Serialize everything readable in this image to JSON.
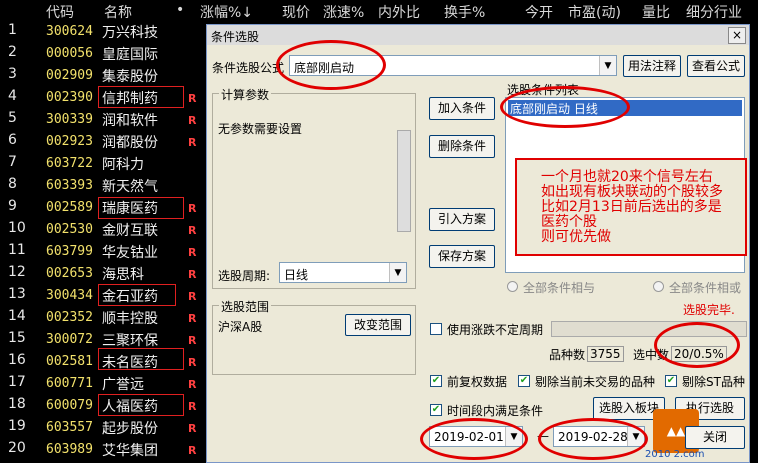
{
  "header": {
    "cols": [
      "代码",
      "名称",
      "•",
      "涨幅%↓",
      "现价",
      "涨速%",
      "内外比",
      "换手%",
      "今开",
      "市盈(动)",
      "量比",
      "细分行业"
    ]
  },
  "stocks": [
    {
      "num": "1",
      "code": "300624",
      "name": "万兴科技",
      "flag": ""
    },
    {
      "num": "2",
      "code": "000056",
      "name": "皇庭国际",
      "flag": ""
    },
    {
      "num": "3",
      "code": "002909",
      "name": "集泰股份",
      "flag": ""
    },
    {
      "num": "4",
      "code": "002390",
      "name": "信邦制药",
      "flag": "R"
    },
    {
      "num": "5",
      "code": "300339",
      "name": "润和软件",
      "flag": "R"
    },
    {
      "num": "6",
      "code": "002923",
      "name": "润都股份",
      "flag": "R"
    },
    {
      "num": "7",
      "code": "603722",
      "name": "阿科力",
      "flag": ""
    },
    {
      "num": "8",
      "code": "603393",
      "name": "新天然气",
      "flag": ""
    },
    {
      "num": "9",
      "code": "002589",
      "name": "瑞康医药",
      "flag": "R"
    },
    {
      "num": "10",
      "code": "002530",
      "name": "金财互联",
      "flag": "R"
    },
    {
      "num": "11",
      "code": "603799",
      "name": "华友钴业",
      "flag": "R"
    },
    {
      "num": "12",
      "code": "002653",
      "name": "海思科",
      "flag": "R"
    },
    {
      "num": "13",
      "code": "300434",
      "name": "金石亚药",
      "flag": "R"
    },
    {
      "num": "14",
      "code": "002352",
      "name": "顺丰控股",
      "flag": "R"
    },
    {
      "num": "15",
      "code": "300072",
      "name": "三聚环保",
      "flag": "R"
    },
    {
      "num": "16",
      "code": "002581",
      "name": "未名医药",
      "flag": "R"
    },
    {
      "num": "17",
      "code": "600771",
      "name": "广誉远",
      "flag": "R"
    },
    {
      "num": "18",
      "code": "600079",
      "name": "人福医药",
      "flag": "R"
    },
    {
      "num": "19",
      "code": "603557",
      "name": "起步股份",
      "flag": "R"
    },
    {
      "num": "20",
      "code": "603989",
      "name": "艾华集团",
      "flag": "R"
    }
  ],
  "dialog": {
    "title": "条件选股",
    "close": "×",
    "formula_label": "条件选股公式",
    "formula_value": "底部刚启动",
    "usage_btn": "用法注释",
    "view_btn": "查看公式",
    "params_group": "计算参数",
    "params_text": "无参数需要设置",
    "period_label": "选股周期:",
    "period_value": "日线",
    "add_btn": "加入条件",
    "delete_btn": "删除条件",
    "import_btn": "引入方案",
    "save_btn": "保存方案",
    "cond_list_label": "选股条件列表",
    "cond_item": "底部刚启动   日线",
    "radio_and": "全部条件相与",
    "radio_or": "全部条件相或",
    "done_text": "选股完毕.",
    "scope_group": "选股范围",
    "scope_value": "沪深A股",
    "change_scope_btn": "改变范围",
    "use_limit_label": "使用涨跌不定周期",
    "count_label": "品种数",
    "count_value": "3755",
    "selected_label": "选中数",
    "selected_value": "20/0.5%",
    "opt_adjusted": "前复权数据",
    "opt_exclude_untraded": "剔除当前未交易的品种",
    "opt_exclude_st": "剔除ST品种",
    "opt_time_range": "时间段内满足条件",
    "select_to_board_btn": "选股入板块",
    "execute_btn": "执行选股",
    "date_from": "2019-02-01",
    "date_to": "2019-02-28",
    "close_btn": "关闭",
    "watermark_url": "2010 2.com"
  },
  "annotation": {
    "lines": [
      "一个月也就20来个信号左右",
      "如出现有板块联动的个股较多",
      "比如2月13日前后选出的多是",
      "医药个股",
      "则可优先做"
    ]
  },
  "colors": {
    "code": "#f2e16b",
    "flag": "#ff4040",
    "annotation": "#e00000",
    "selection": "#316ac5"
  }
}
